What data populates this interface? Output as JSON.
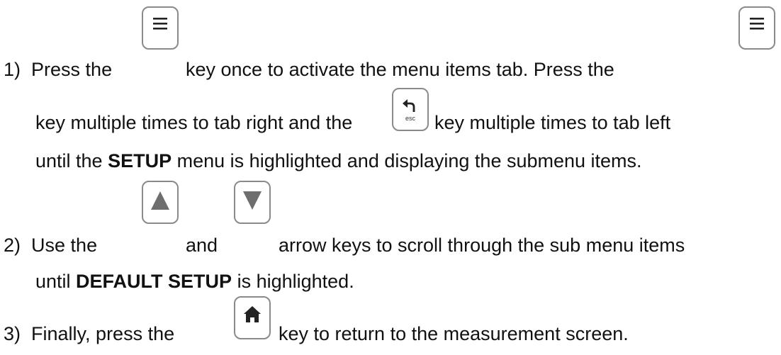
{
  "steps": [
    {
      "number": "1)",
      "line1": {
        "a": "Press the",
        "b": "key once to activate the menu items tab.  Press the"
      },
      "line2": {
        "a": "key multiple times to tab right and the",
        "b": "key multiple times to tab left"
      },
      "line3": {
        "a": "until the",
        "bold": "SETUP",
        "b": "menu is highlighted and displaying the submenu items."
      }
    },
    {
      "number": "2)",
      "line1": {
        "a": "Use the",
        "b": "and",
        "c": "arrow keys to scroll through the sub menu items"
      },
      "line2": {
        "a": "until",
        "bold": "DEFAULT SETUP",
        "b": "is highlighted."
      }
    },
    {
      "number": "3)",
      "line1": {
        "a": "Finally, press the",
        "b": "key to return to the measurement screen."
      }
    }
  ],
  "keys": {
    "menu": "menu-icon",
    "esc": {
      "icon": "back-arrow-icon",
      "label": "esc"
    },
    "up": "up-arrow-icon",
    "down": "down-arrow-icon",
    "home": "home-icon"
  }
}
